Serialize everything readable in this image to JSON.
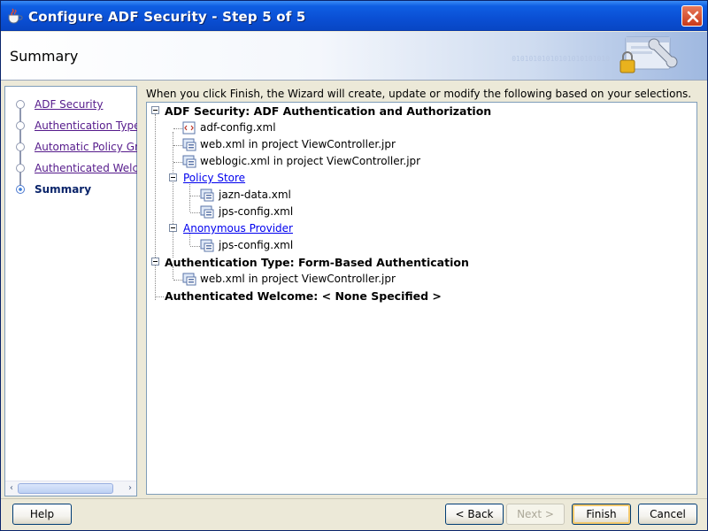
{
  "window": {
    "title": "Configure ADF Security - Step 5 of 5"
  },
  "header": {
    "title": "Summary",
    "bits": "01010101010101010101010"
  },
  "sidebar": {
    "steps": [
      {
        "label": "ADF Security",
        "current": false
      },
      {
        "label": "Authentication Type",
        "current": false
      },
      {
        "label": "Automatic Policy Grant",
        "current": false
      },
      {
        "label": "Authenticated Welcome",
        "current": false
      },
      {
        "label": "Summary",
        "current": true
      }
    ]
  },
  "main": {
    "intro": "When you click Finish, the Wizard will create, update or modify the following based on your selections.",
    "tree": {
      "adf_security": "ADF Security:  ADF Authentication and Authorization",
      "adf_config": "adf-config.xml",
      "web_xml": "web.xml in project ViewController.jpr",
      "weblogic_xml": "weblogic.xml in project ViewController.jpr",
      "policy_store": "Policy Store",
      "jazn_data": "jazn-data.xml",
      "jps_config_1": "jps-config.xml",
      "anonymous_provider": "Anonymous Provider",
      "jps_config_2": "jps-config.xml",
      "auth_type": "Authentication Type:  Form-Based Authentication",
      "auth_web_xml": "web.xml in project ViewController.jpr",
      "auth_welcome": "Authenticated Welcome:  < None Specified >"
    }
  },
  "buttons": {
    "help": "Help",
    "back": "< Back",
    "next": "Next >",
    "finish": "Finish",
    "cancel": "Cancel"
  }
}
